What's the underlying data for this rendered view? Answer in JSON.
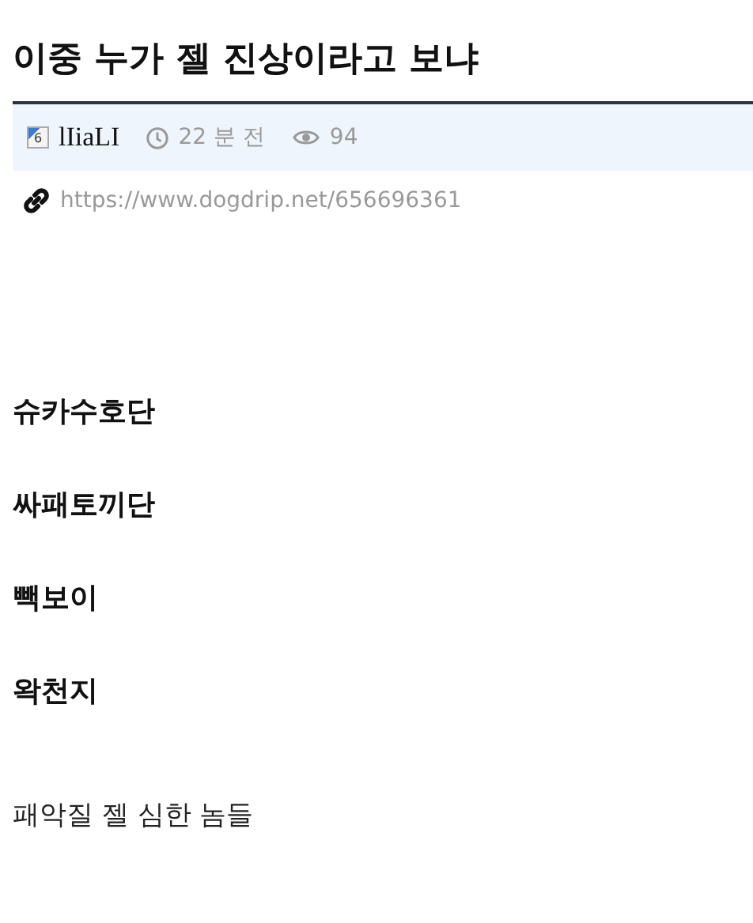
{
  "title": "이중 누가 젤 진상이라고 보냐",
  "meta": {
    "level_badge": "6",
    "author": "lIiaLI",
    "time": "22 분 전",
    "views": "94"
  },
  "link": "https://www.dogdrip.net/656696361",
  "body": [
    {
      "kind": "heading",
      "text": "슈카수호단"
    },
    {
      "kind": "heading",
      "text": "싸패토끼단"
    },
    {
      "kind": "heading",
      "text": "빽보이"
    },
    {
      "kind": "heading",
      "text": "왁천지"
    },
    {
      "kind": "paragraph",
      "text": "패악질 젤 심한 놈들"
    }
  ]
}
